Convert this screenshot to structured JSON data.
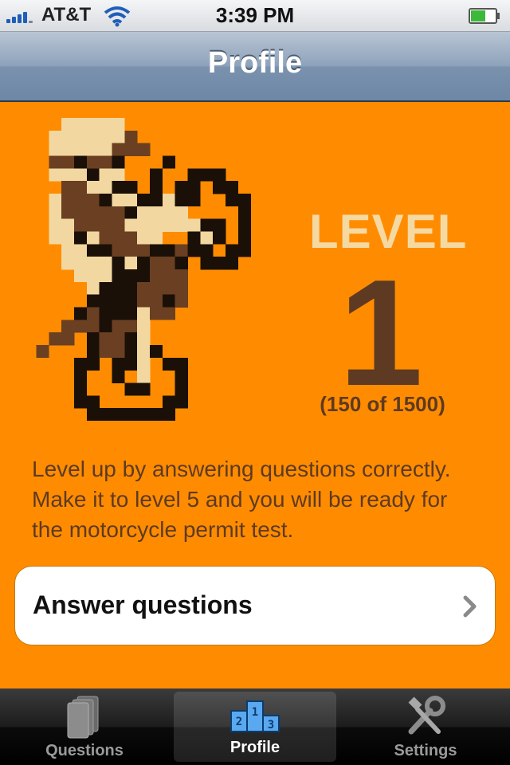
{
  "status_bar": {
    "carrier": "AT&T",
    "time": "3:39 PM",
    "signal_bars": 4,
    "battery_level": 0.6
  },
  "nav": {
    "title": "Profile"
  },
  "profile": {
    "level_label": "LEVEL",
    "level_number": "1",
    "level_progress": "(150 of 1500)",
    "description": "Level up by answering questions correctly. Make it to level 5 and you will be ready for the motorcycle permit test.",
    "answer_button_label": "Answer questions"
  },
  "tabs": [
    {
      "label": "Questions",
      "icon": "cards-icon",
      "selected": false
    },
    {
      "label": "Profile",
      "icon": "podium-icon",
      "selected": true
    },
    {
      "label": "Settings",
      "icon": "tools-icon",
      "selected": false
    }
  ],
  "colors": {
    "background": "#FF8C00",
    "level_label": "#F5D9A2",
    "brown_text": "#5E3A22",
    "rider_cream": "#F2D8A0",
    "rider_brown": "#6B3F22",
    "rider_black": "#1A1008",
    "status_blue": "#1f5fb8"
  }
}
